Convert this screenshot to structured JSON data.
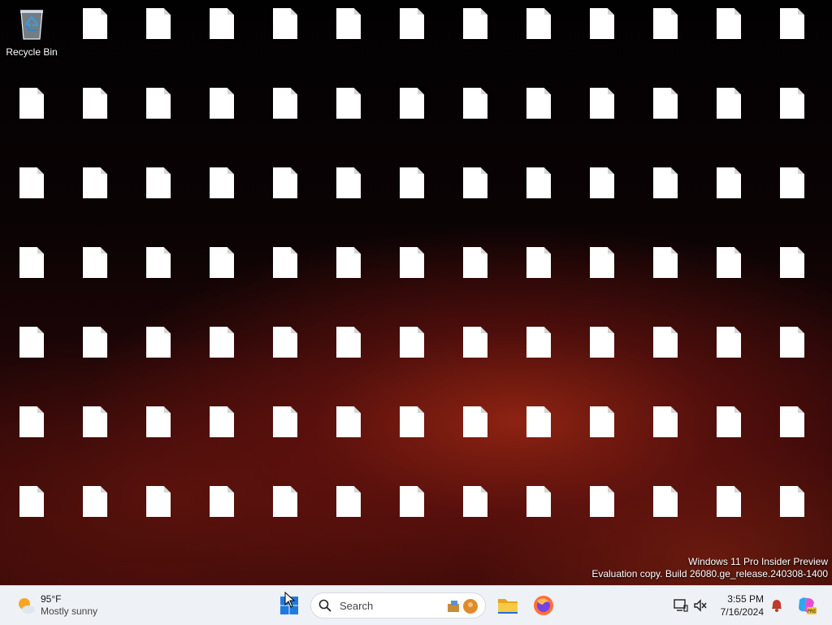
{
  "desktop": {
    "recycle_bin_label": "Recycle Bin",
    "file_icons_note": "file labels are unreadable random glyph strings",
    "file_labels": [
      "",
      "",
      "",
      "",
      "",
      "",
      "",
      "",
      "",
      "",
      "",
      "",
      "",
      "",
      "",
      "",
      "",
      "",
      "",
      "",
      "",
      "",
      "",
      "",
      "",
      "",
      "",
      "",
      "",
      "",
      "",
      "",
      "",
      "",
      "",
      "",
      "",
      "",
      "",
      "",
      "",
      "",
      "",
      "",
      "",
      "",
      "",
      "",
      "",
      "",
      "",
      "",
      "",
      "",
      "",
      "",
      "",
      "",
      "",
      "",
      "",
      "",
      "",
      "",
      "",
      "",
      "",
      "",
      "",
      "",
      "",
      "",
      "",
      "",
      "",
      "",
      "",
      "",
      "",
      "",
      "",
      "",
      "",
      "",
      ""
    ]
  },
  "watermark": {
    "line1": "Windows 11 Pro Insider Preview",
    "line2": "Evaluation copy. Build 26080.ge_release.240308-1400"
  },
  "taskbar": {
    "weather": {
      "temp": "95°F",
      "condition": "Mostly sunny",
      "icon": "sun-cloud-icon"
    },
    "search": {
      "placeholder": "Search"
    },
    "apps": [
      {
        "name": "start",
        "icon": "windows-logo-icon"
      },
      {
        "name": "file-explorer",
        "icon": "folder-icon"
      },
      {
        "name": "firefox",
        "icon": "firefox-icon"
      }
    ],
    "clock": {
      "time": "3:55 PM",
      "date": "7/16/2024"
    },
    "tray": [
      "network-icon",
      "volume-icon",
      "notification-bell-icon",
      "copilot-icon"
    ],
    "colors": {
      "bg": "#eef1f5",
      "accent": "#0067c0"
    }
  }
}
